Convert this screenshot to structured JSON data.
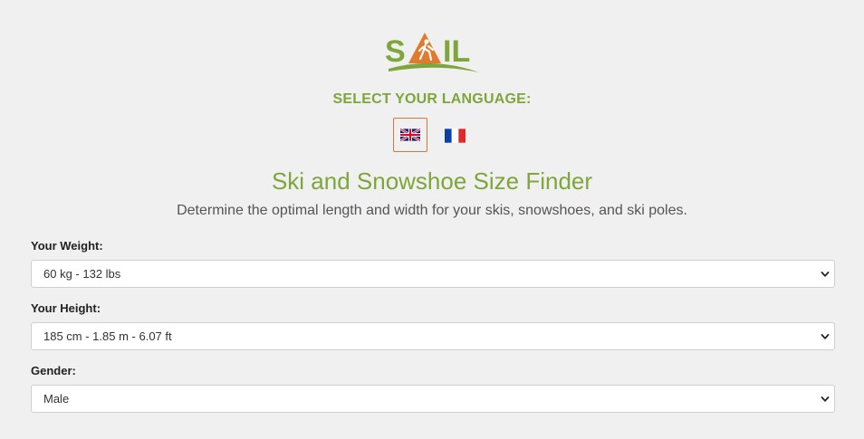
{
  "logo": {
    "text": "SAIL",
    "colors": {
      "green": "#7ea63a",
      "orange": "#e07a2e"
    }
  },
  "language": {
    "heading": "SELECT YOUR LANGUAGE:",
    "options": [
      {
        "flag": "uk-flag-icon",
        "selected": true
      },
      {
        "flag": "france-flag-icon",
        "selected": false
      }
    ]
  },
  "header": {
    "title": "Ski and Snowshoe Size Finder",
    "subtitle": "Determine the optimal length and width for your skis, snowshoes, and ski poles."
  },
  "form": {
    "weight": {
      "label": "Your Weight:",
      "value": "60 kg - 132 lbs"
    },
    "height": {
      "label": "Your Height:",
      "value": "185 cm - 1.85 m - 6.07 ft"
    },
    "gender": {
      "label": "Gender:",
      "value": "Male"
    }
  },
  "colors": {
    "accent": "#7ea63a",
    "selected_border": "#d9773a",
    "background": "#f0f0f0"
  },
  "icons": {
    "dropdown": "chevron-down-icon"
  }
}
